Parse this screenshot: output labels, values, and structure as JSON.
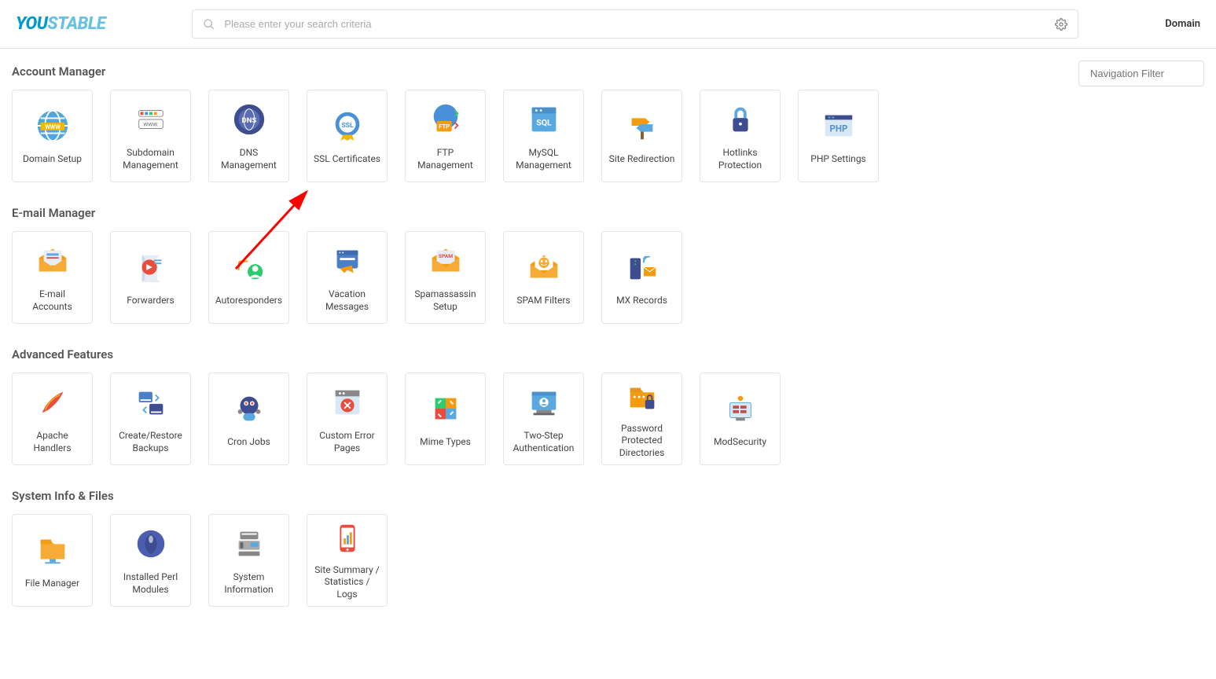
{
  "header": {
    "logo_you": "YOU",
    "logo_stable": "STABLE",
    "search_placeholder": "Please enter your search criteria",
    "domain_label": "Domain"
  },
  "nav_filter_placeholder": "Navigation Filter",
  "sections": {
    "account_manager": {
      "title": "Account Manager",
      "items": [
        "Domain Setup",
        "Subdomain Management",
        "DNS Management",
        "SSL Certificates",
        "FTP Management",
        "MySQL Management",
        "Site Redirection",
        "Hotlinks Protection",
        "PHP Settings"
      ]
    },
    "email_manager": {
      "title": "E-mail Manager",
      "items": [
        "E-mail Accounts",
        "Forwarders",
        "Autoresponders",
        "Vacation Messages",
        "Spamassassin Setup",
        "SPAM Filters",
        "MX Records"
      ]
    },
    "advanced_features": {
      "title": "Advanced Features",
      "items": [
        "Apache Handlers",
        "Create/Restore Backups",
        "Cron Jobs",
        "Custom Error Pages",
        "Mime Types",
        "Two-Step Authentication",
        "Password Protected Directories",
        "ModSecurity"
      ]
    },
    "system_info": {
      "title": "System Info & Files",
      "items": [
        "File Manager",
        "Installed Perl Modules",
        "System Information",
        "Site Summary / Statistics / Logs"
      ]
    }
  }
}
